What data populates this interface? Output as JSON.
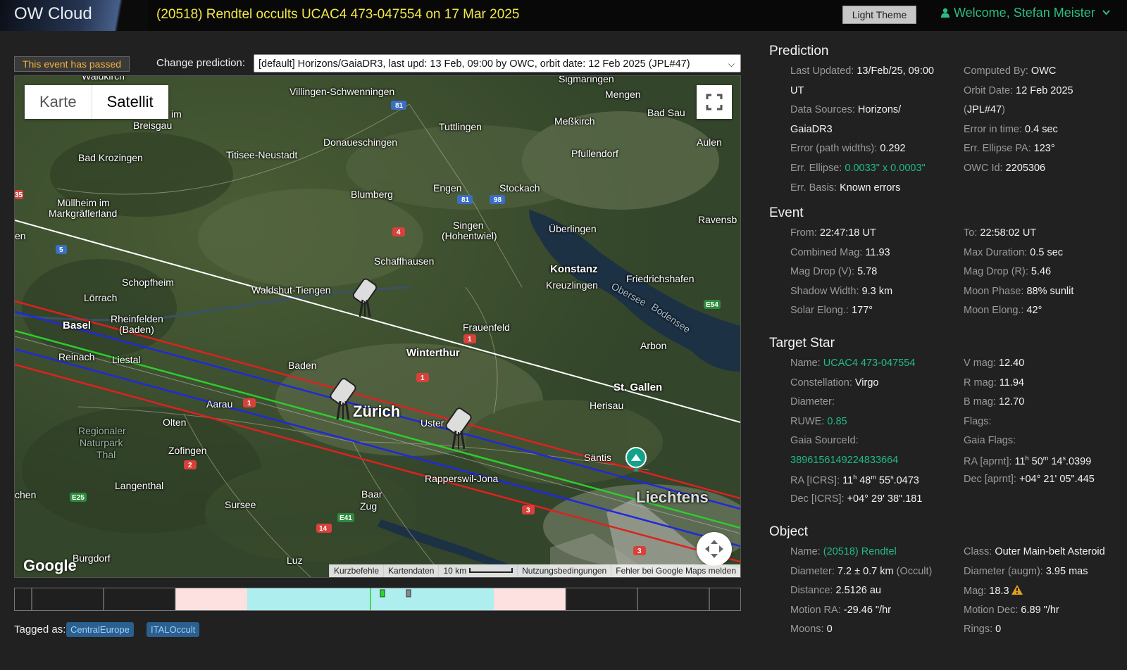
{
  "app": {
    "brand": "OW Cloud",
    "event_title": "(20518) Rendtel occults UCAC4 473-047554 on 17 Mar 2025",
    "theme_button": "Light Theme",
    "welcome": "Welcome, Stefan Meister"
  },
  "controls": {
    "passed_badge": "This event has passed",
    "change_label": "Change prediction:",
    "prediction_value": "[default] Horizons/GaiaDR3, last upd: 13 Feb, 09:00 by OWC, orbit date: 12 Feb 2025 (JPL#47)"
  },
  "map": {
    "type_buttons": [
      "Karte",
      "Satellit"
    ],
    "logo": "Google",
    "attribution": [
      "Kurzbefehle",
      "Kartendaten",
      "10 km",
      "Nutzungsbedingungen",
      "Fehler bei Google Maps melden"
    ],
    "labels": {
      "l1": "Villingen-Schwenningen",
      "l2": "Sigmaringen",
      "l3": "Mengen",
      "l4": "Bad Sau",
      "l5": "im",
      "l6": "Breisgau",
      "l7": "Tuttlingen",
      "l8": "Meßkirch",
      "l9": "Titisee-Neustadt",
      "l10": "Donaueschingen",
      "l11": "Pfullendorf",
      "l12": "Aulen",
      "l13": "Bad Krozingen",
      "l14": "Blumberg",
      "l15": "Engen",
      "l16": "Stockach",
      "l17": "Müllheim im",
      "l18": "Markgräflerland",
      "l19": "Singen",
      "l20": "(Hohentwiel)",
      "l21": "Überlingen",
      "l22": "Ravensb",
      "l23": "Schaffhausen",
      "l24": "Konstanz",
      "l25": "Friedrichshafen",
      "l26": "Schopfheim",
      "l27": "Waldshut-Tiengen",
      "l28": "Kreuzlingen",
      "l29": "Lörrach",
      "l30": "Rheinfelden",
      "l31": "(Baden)",
      "l32": "Basel",
      "l33": "Frauenfeld",
      "l34": "Arbon",
      "l35": "Winterthur",
      "l36": "Reinach",
      "l37": "Liestal",
      "l38": "Baden",
      "l39": "St. Gallen",
      "l40": "Aarau",
      "l41": "Zürich",
      "l42": "Uster",
      "l43": "Herisau",
      "l44": "Regionaler",
      "l45": "Naturpark",
      "l46": "Thal",
      "l47": "Olten",
      "l48": "Zofingen",
      "l49": "Säntis",
      "l50": "Langenthal",
      "l51": "Rapperswil-Jona",
      "l52": "Liechtens",
      "l53": "Baar",
      "l54": "Zug",
      "l55": "Sursee",
      "l56": "chen",
      "l57": "Burgdorf",
      "l58": "Luz",
      "l59": "Waldkirch",
      "l60": "Obersee",
      "l61": "Bodensee",
      "l62": "en"
    },
    "shields": {
      "s1": "81",
      "s2": "81",
      "s3": "98",
      "s4": "4",
      "s5": "5",
      "s6": "1",
      "s7": "1",
      "s8": "1",
      "s9": "2",
      "s10": "14",
      "s11": "E41",
      "s12": "E25",
      "s13": "E54",
      "s14": "3",
      "s15": "3",
      "s16": "35"
    }
  },
  "tags": {
    "label": "Tagged as:",
    "items": [
      "CentralEurope",
      "ITALOccult"
    ]
  },
  "prediction": {
    "heading": "Prediction",
    "last_updated_label": "Last Updated:",
    "last_updated_1": "13/Feb/25, 09:00",
    "last_updated_2": "UT",
    "computed_by_label": "Computed By:",
    "computed_by": "OWC",
    "orbit_date_label": "Orbit Date:",
    "orbit_date": "12 Feb 2025",
    "orbit_ref": "JPL#47",
    "data_sources_label": "Data Sources:",
    "data_sources_1": "Horizons/",
    "data_sources_2": "GaiaDR3",
    "error_time_label": "Error in time:",
    "error_time": "0.4 sec",
    "error_path_label": "Error (path widths):",
    "error_path": "0.292",
    "err_pa_label": "Err. Ellipse PA:",
    "err_pa": "123°",
    "err_ellipse_label": "Err. Ellipse:",
    "err_ellipse": "0.0033\" x 0.0003\"",
    "owc_id_label": "OWC Id:",
    "owc_id": "2205306",
    "err_basis_label": "Err. Basis:",
    "err_basis": "Known errors"
  },
  "event": {
    "heading": "Event",
    "from_label": "From:",
    "from": "22:47:18 UT",
    "to_label": "To:",
    "to": "22:58:02 UT",
    "comb_mag_label": "Combined Mag:",
    "comb_mag": "11.93",
    "max_dur_label": "Max Duration:",
    "max_dur": "0.5 sec",
    "drop_v_label": "Mag Drop (V):",
    "drop_v": "5.78",
    "drop_r_label": "Mag Drop (R):",
    "drop_r": "5.46",
    "shadow_label": "Shadow Width:",
    "shadow": "9.3 km",
    "moon_phase_label": "Moon Phase:",
    "moon_phase": "88% sunlit",
    "solar_label": "Solar Elong.:",
    "solar": "177°",
    "moon_elong_label": "Moon Elong.:",
    "moon_elong": "42°"
  },
  "star": {
    "heading": "Target Star",
    "name_label": "Name:",
    "name": "UCAC4 473-047554",
    "vmag_label": "V mag:",
    "vmag": "12.40",
    "const_label": "Constellation:",
    "const": "Virgo",
    "rmag_label": "R mag:",
    "rmag": "11.94",
    "diam_label": "Diameter:",
    "bmag_label": "B mag:",
    "bmag": "12.70",
    "ruwe_label": "RUWE:",
    "ruwe": "0.85",
    "flags_label": "Flags:",
    "gaia_id_label": "Gaia SourceId:",
    "gaia_flags_label": "Gaia Flags:",
    "gaia_id": "3896156149224833664",
    "ra_aprnt_label": "RA [aprnt]:",
    "ra_aprnt": [
      "11",
      "h",
      " 50",
      "m",
      " 14",
      "s",
      ".0399"
    ],
    "ra_icrs_label": "RA [ICRS]:",
    "ra_icrs": [
      "11",
      "h",
      " 48",
      "m",
      " 55",
      "s",
      ".0473"
    ],
    "dec_aprnt_label": "Dec [aprnt]:",
    "dec_aprnt": "+04° 21' 05\".445",
    "dec_icrs_label": "Dec [ICRS]:",
    "dec_icrs": "+04° 29' 38\".181"
  },
  "object": {
    "heading": "Object",
    "name_label": "Name:",
    "name": "(20518) Rendtel",
    "class_label": "Class:",
    "class": "Outer Main-belt Asteroid",
    "diam_label": "Diameter:",
    "diam": "7.2 ± 0.7 km",
    "diam_src": "(Occult)",
    "diam_augm_label": "Diameter (augm):",
    "diam_augm": "3.95 mas",
    "dist_label": "Distance:",
    "dist": "2.5126 au",
    "mag_label": "Mag:",
    "mag": "18.3",
    "mra_label": "Motion RA:",
    "mra": "-29.46 \"/hr",
    "mdec_label": "Motion Dec:",
    "mdec": "6.89 \"/hr",
    "moons_label": "Moons:",
    "moons": "0",
    "rings_label": "Rings:",
    "rings": "0"
  },
  "colors": {
    "accent": "#21b98a",
    "title": "#f3e84b",
    "warning": "#f4b13a",
    "path_center": "#2ecc2e",
    "path_edge": "#1f2ee6",
    "path_error": "#e62020",
    "path_other": "#ffffff"
  }
}
